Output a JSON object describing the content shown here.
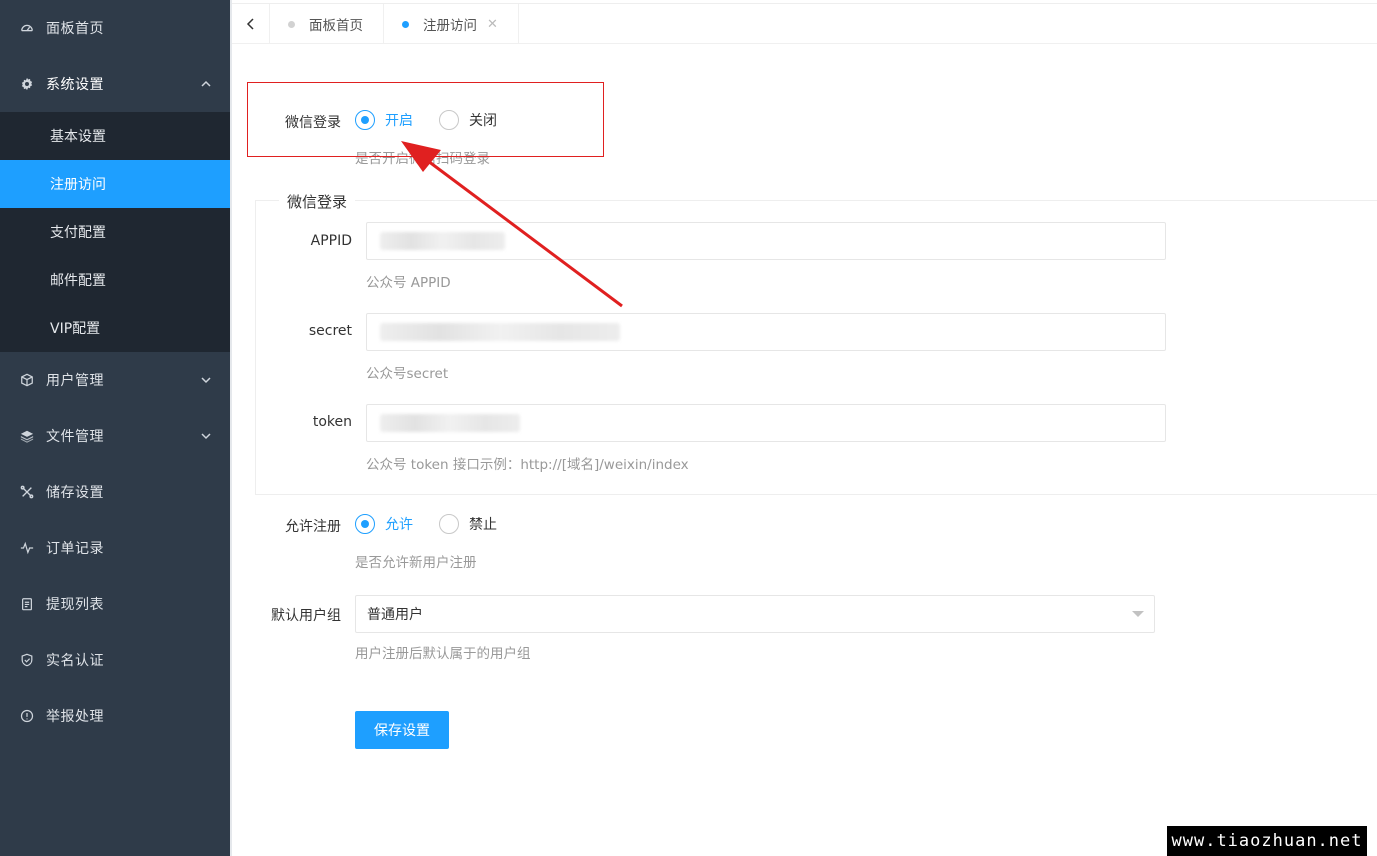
{
  "sidebar": {
    "items": [
      {
        "label": "面板首页",
        "icon": "dashboard-icon"
      },
      {
        "label": "系统设置",
        "icon": "gear-icon"
      },
      {
        "label": "用户管理",
        "icon": "cube-icon"
      },
      {
        "label": "文件管理",
        "icon": "layers-icon"
      },
      {
        "label": "储存设置",
        "icon": "tools-icon"
      },
      {
        "label": "订单记录",
        "icon": "pulse-icon"
      },
      {
        "label": "提现列表",
        "icon": "clipboard-icon"
      },
      {
        "label": "实名认证",
        "icon": "shield-check-icon"
      },
      {
        "label": "举报处理",
        "icon": "info-circle-icon"
      }
    ],
    "submenu": [
      "基本设置",
      "注册访问",
      "支付配置",
      "邮件配置",
      "VIP配置"
    ],
    "active_sub": "注册访问"
  },
  "tabs": [
    {
      "label": "面板首页",
      "active": false
    },
    {
      "label": "注册访问",
      "active": true,
      "close": "✕"
    }
  ],
  "form": {
    "wechat_login": {
      "label": "微信登录",
      "option_on": "开启",
      "option_off": "关闭",
      "selected": "开启",
      "help": "是否开启微信扫码登录"
    },
    "fieldset_title": "微信登录",
    "appid": {
      "label": "APPID",
      "help": "公众号 APPID"
    },
    "secret": {
      "label": "secret",
      "help": "公众号secret"
    },
    "token": {
      "label": "token",
      "help": "公众号 token 接口示例：http://[域名]/weixin/index"
    },
    "allow_register": {
      "label": "允许注册",
      "option_on": "允许",
      "option_off": "禁止",
      "selected": "允许",
      "help": "是否允许新用户注册"
    },
    "default_group": {
      "label": "默认用户组",
      "value": "普通用户",
      "help": "用户注册后默认属于的用户组"
    },
    "save_label": "保存设置"
  },
  "colors": {
    "accent": "#1e9fff",
    "sidebar_bg": "#2f3b49",
    "submenu_bg": "#1f2731",
    "annotation": "#e02020"
  },
  "watermark": "www.tiaozhuan.net"
}
